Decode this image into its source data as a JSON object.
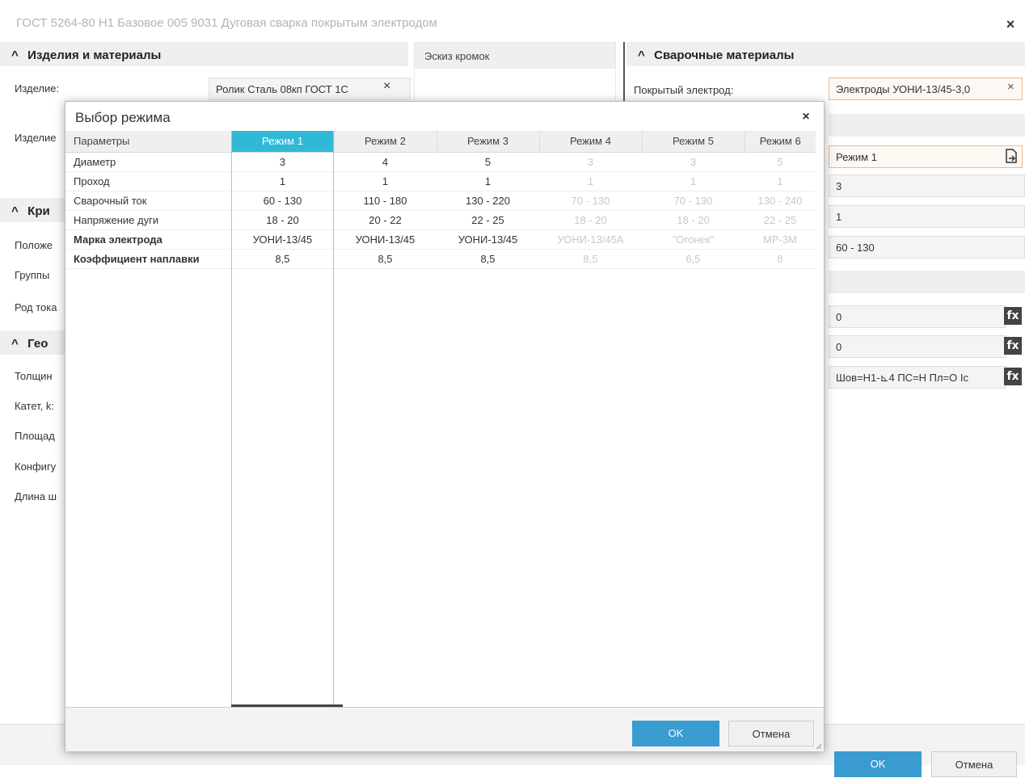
{
  "window": {
    "title": "ГОСТ 5264-80 Н1 Базовое 005  9031 Дуговая сварка покрытым электродом",
    "close_glyph": "×"
  },
  "left_panel": {
    "section_products": "Изделия и материалы",
    "label_product": "Изделие:",
    "product_value": "Ролик Сталь 08кп ГОСТ 1С",
    "clear_glyph": "×",
    "label_product2": "Изделие",
    "section_criteria": "Кри",
    "label_position": "Положе",
    "label_groups": "Группы",
    "label_current": "Род тока",
    "section_geometry": "Гео",
    "label_thickness": "Толщин",
    "label_leg": "Катет, k:",
    "label_area": "Площад",
    "label_config": "Конфигу",
    "label_length": "Длина ш"
  },
  "sketch": {
    "title": "Эскиз кромок"
  },
  "right_panel": {
    "section_title": "Сварочные материалы",
    "label_electrode": "Покрытый электрод:",
    "electrode_value": "Электроды УОНИ-13/45-3,0",
    "clear_glyph": "×",
    "mode_value": "Режим 1",
    "diameter_value": "3",
    "pass_value": "1",
    "current_value": "60 - 130",
    "formula1": "0",
    "formula2": "0",
    "formula3": "Шов=Н1-⊾4 ПС=Н Пл=О Ic",
    "fx_label": "fx"
  },
  "main_buttons": {
    "ok": "OK",
    "cancel": "Отмена"
  },
  "dialog": {
    "title": "Выбор режима",
    "close_glyph": "×",
    "headers": [
      "Параметры",
      "Режим 1",
      "Режим 2",
      "Режим 3",
      "Режим 4",
      "Режим 5",
      "Режим 6"
    ],
    "rows": [
      {
        "param": "Диаметр",
        "bold": false,
        "values": [
          "3",
          "4",
          "5",
          "3",
          "3",
          "5"
        ]
      },
      {
        "param": "Проход",
        "bold": false,
        "values": [
          "1",
          "1",
          "1",
          "1",
          "1",
          "1"
        ]
      },
      {
        "param": "Сварочный ток",
        "bold": false,
        "values": [
          "60 - 130",
          "110 - 180",
          "130 - 220",
          "70 - 130",
          "70 - 130",
          "130 - 240"
        ]
      },
      {
        "param": "Напряжение дуги",
        "bold": false,
        "values": [
          "18 - 20",
          "20 - 22",
          "22 - 25",
          "18 - 20",
          "18 - 20",
          "22 - 25"
        ]
      },
      {
        "param": "Марка электрода",
        "bold": true,
        "values": [
          "УОНИ-13/45",
          "УОНИ-13/45",
          "УОНИ-13/45",
          "УОНИ-13/45А",
          "\"Огонек\"",
          "МР-3М"
        ]
      },
      {
        "param": "Коэффициент наплавки",
        "bold": true,
        "values": [
          "8,5",
          "8,5",
          "8,5",
          "8,5",
          "6,5",
          "8"
        ]
      }
    ],
    "ok": "OK",
    "cancel": "Отмена"
  }
}
